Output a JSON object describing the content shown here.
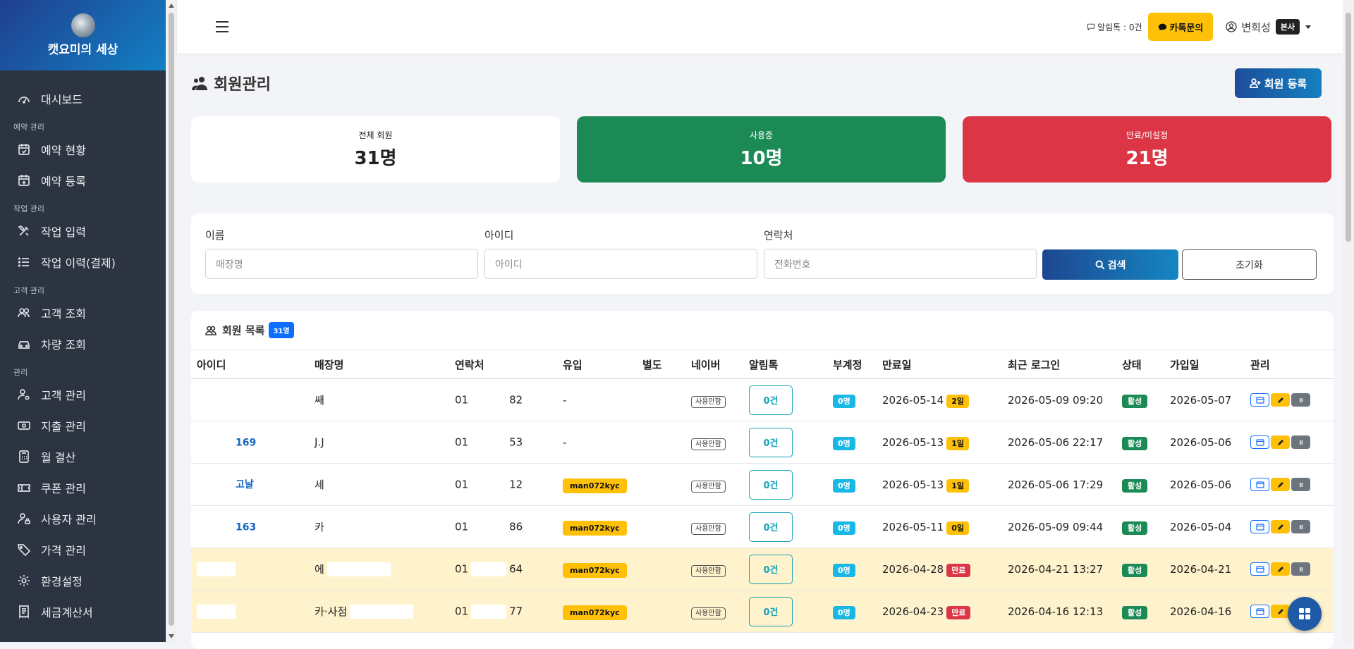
{
  "brand": {
    "name": "캣요미의 세상"
  },
  "sidebar": {
    "items": [
      {
        "type": "item",
        "label": "대시보드",
        "icon": "dashboard-icon"
      },
      {
        "type": "section",
        "label": "예약 관리"
      },
      {
        "type": "item",
        "label": "예약 현황",
        "icon": "calendar-check-icon"
      },
      {
        "type": "item",
        "label": "예약 등록",
        "icon": "calendar-plus-icon"
      },
      {
        "type": "section",
        "label": "작업 관리"
      },
      {
        "type": "item",
        "label": "작업 입력",
        "icon": "tools-icon"
      },
      {
        "type": "item",
        "label": "작업 이력(결제)",
        "icon": "list-icon"
      },
      {
        "type": "section",
        "label": "고객 관리"
      },
      {
        "type": "item",
        "label": "고객 조회",
        "icon": "people-icon"
      },
      {
        "type": "item",
        "label": "차량 조회",
        "icon": "car-icon"
      },
      {
        "type": "section",
        "label": "관리"
      },
      {
        "type": "item",
        "label": "고객 관리",
        "icon": "person-gear-icon"
      },
      {
        "type": "item",
        "label": "지출 관리",
        "icon": "cash-icon"
      },
      {
        "type": "item",
        "label": "월 결산",
        "icon": "calculator-icon"
      },
      {
        "type": "item",
        "label": "쿠폰 관리",
        "icon": "ticket-icon"
      },
      {
        "type": "item",
        "label": "사용자 관리",
        "icon": "person-lock-icon"
      },
      {
        "type": "item",
        "label": "가격 관리",
        "icon": "tag-icon"
      },
      {
        "type": "item",
        "label": "환경설정",
        "icon": "gear-icon"
      },
      {
        "type": "item",
        "label": "세금계산서",
        "icon": "receipt-icon"
      }
    ]
  },
  "topbar": {
    "alimtalk": "알림톡 : 0건",
    "kakao_button": "카톡문의",
    "user_name": "변희성",
    "user_badge": "본사"
  },
  "page": {
    "title": "회원관리",
    "register_button": "회원 등록"
  },
  "stats": {
    "total_label": "전체 회원",
    "total_value": "31명",
    "active_label": "사용중",
    "active_value": "10명",
    "expired_label": "만료/미설정",
    "expired_value": "21명"
  },
  "search": {
    "name_label": "이름",
    "name_placeholder": "매장명",
    "id_label": "아이디",
    "id_placeholder": "아이디",
    "phone_label": "연락처",
    "phone_placeholder": "전화번호",
    "search_button": "검색",
    "reset_button": "초기화"
  },
  "list": {
    "title": "회원 목록",
    "count": "31명",
    "columns": [
      "아이디",
      "매장명",
      "연락처",
      "유입",
      "별도",
      "네이버",
      "알림톡",
      "부계정",
      "만료일",
      "최근 로그인",
      "상태",
      "가입일",
      "관리"
    ],
    "rows": [
      {
        "id": "",
        "store": "쌔",
        "phone_a": "01",
        "phone_b": "82",
        "inflow": "-",
        "naver": "사용안함",
        "alim": "0건",
        "sub": "0명",
        "expire": "2026-05-14",
        "dday": "2일",
        "expired": false,
        "login": "2026-05-09 09:20",
        "status": "활성",
        "joined": "2026-05-07"
      },
      {
        "id": "169",
        "store": "J.J",
        "phone_a": "01",
        "phone_b": "53",
        "inflow": "-",
        "naver": "사용안함",
        "alim": "0건",
        "sub": "0명",
        "expire": "2026-05-13",
        "dday": "1일",
        "expired": false,
        "login": "2026-05-06 22:17",
        "status": "활성",
        "joined": "2026-05-06"
      },
      {
        "id": "고날",
        "store": "세",
        "phone_a": "01",
        "phone_b": "12",
        "inflow": "man072kyc",
        "naver": "사용안함",
        "alim": "0건",
        "sub": "0명",
        "expire": "2026-05-13",
        "dday": "1일",
        "expired": false,
        "login": "2026-05-06 17:29",
        "status": "활성",
        "joined": "2026-05-06"
      },
      {
        "id": "163",
        "store": "카",
        "phone_a": "01",
        "phone_b": "86",
        "inflow": "man072kyc",
        "naver": "사용안함",
        "alim": "0건",
        "sub": "0명",
        "expire": "2026-05-11",
        "dday": "0일",
        "expired": false,
        "login": "2026-05-09 09:44",
        "status": "활성",
        "joined": "2026-05-04"
      },
      {
        "id": "",
        "store": "에",
        "phone_a": "01",
        "phone_b": "64",
        "inflow": "man072kyc",
        "naver": "사용안함",
        "alim": "0건",
        "sub": "0명",
        "expire": "2026-04-28",
        "dday": "만료",
        "expired": true,
        "login": "2026-04-21 13:27",
        "status": "활성",
        "joined": "2026-04-21"
      },
      {
        "id": "",
        "store": "카·사점",
        "phone_a": "01",
        "phone_b": "77",
        "inflow": "man072kyc",
        "naver": "사용안함",
        "alim": "0건",
        "sub": "0명",
        "expire": "2026-04-23",
        "dday": "만료",
        "expired": true,
        "login": "2026-04-16 12:13",
        "status": "활성",
        "joined": "2026-04-16"
      }
    ]
  }
}
